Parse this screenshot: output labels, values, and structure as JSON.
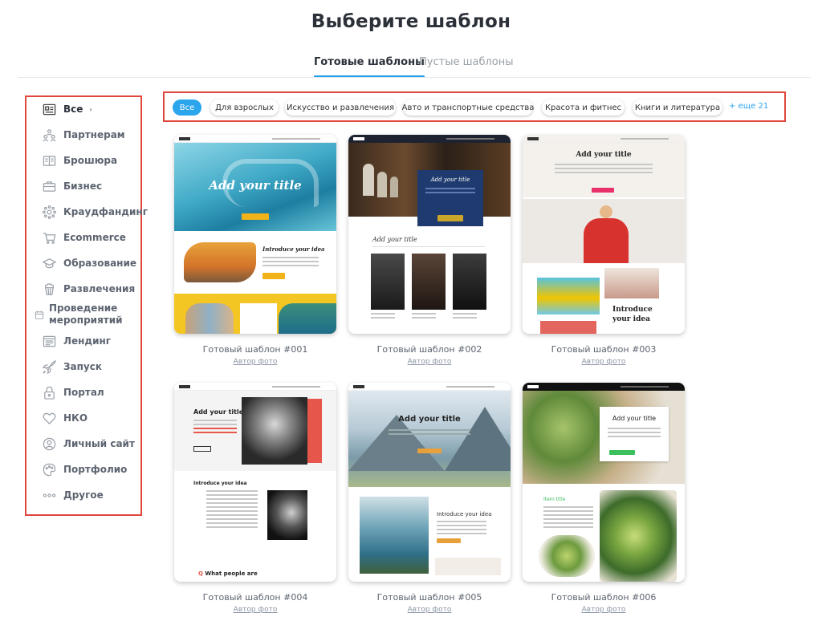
{
  "header": {
    "title": "Выберите шаблон"
  },
  "tabs": [
    {
      "label": "Готовые шаблоны",
      "active": true
    },
    {
      "label": "Пустые шаблоны",
      "active": false
    }
  ],
  "sidebar": {
    "items": [
      {
        "label": "Все",
        "icon": "layout-icon",
        "active": true
      },
      {
        "label": "Партнерам",
        "icon": "people-icon"
      },
      {
        "label": "Брошюра",
        "icon": "brochure-icon"
      },
      {
        "label": "Бизнес",
        "icon": "briefcase-icon"
      },
      {
        "label": "Краудфандинг",
        "icon": "network-icon"
      },
      {
        "label": "Ecommerce",
        "icon": "cart-icon"
      },
      {
        "label": "Образование",
        "icon": "graduation-cap-icon"
      },
      {
        "label": "Развлечения",
        "icon": "popcorn-icon"
      },
      {
        "label": "Проведение мероприятий",
        "icon": "calendar-icon"
      },
      {
        "label": "Лендинг",
        "icon": "landing-page-icon"
      },
      {
        "label": "Запуск",
        "icon": "rocket-icon"
      },
      {
        "label": "Портал",
        "icon": "lock-icon"
      },
      {
        "label": "НКО",
        "icon": "heart-icon"
      },
      {
        "label": "Личный сайт",
        "icon": "person-icon"
      },
      {
        "label": "Портфолио",
        "icon": "palette-icon"
      },
      {
        "label": "Другое",
        "icon": "dots-icon"
      }
    ],
    "caret": "›"
  },
  "filters": {
    "chips": [
      "Все",
      "Для взрослых",
      "Искусство и развлечения",
      "Авто и транспортные средства",
      "Красота и фитнес",
      "Книги и литература"
    ],
    "more": "+ еще 21"
  },
  "templates": [
    {
      "name": "Готовый шаблон #001",
      "credit": "Автор фото",
      "preview": {
        "title": "Add your title",
        "subtitle": "Introduce your idea"
      }
    },
    {
      "name": "Готовый шаблон #002",
      "credit": "Автор фото",
      "preview": {
        "title": "Add your title",
        "subtitle": "Add your title"
      }
    },
    {
      "name": "Готовый шаблон #003",
      "credit": "Автор фото",
      "preview": {
        "title": "Add your title",
        "subtitle": "Introduce your idea"
      }
    },
    {
      "name": "Готовый шаблон #004",
      "credit": "Автор фото",
      "preview": {
        "title": "Add your title",
        "subtitle": "Introduce your idea",
        "footer": "What people are"
      }
    },
    {
      "name": "Готовый шаблон #005",
      "credit": "Автор фото",
      "preview": {
        "title": "Add your title",
        "subtitle": "Introduce your idea"
      }
    },
    {
      "name": "Готовый шаблон #006",
      "credit": "Автор фото",
      "preview": {
        "title": "Add your title",
        "subtitle": "Item title"
      }
    }
  ],
  "colors": {
    "accent": "#1e9fe8",
    "highlight_border": "#e0463c"
  }
}
